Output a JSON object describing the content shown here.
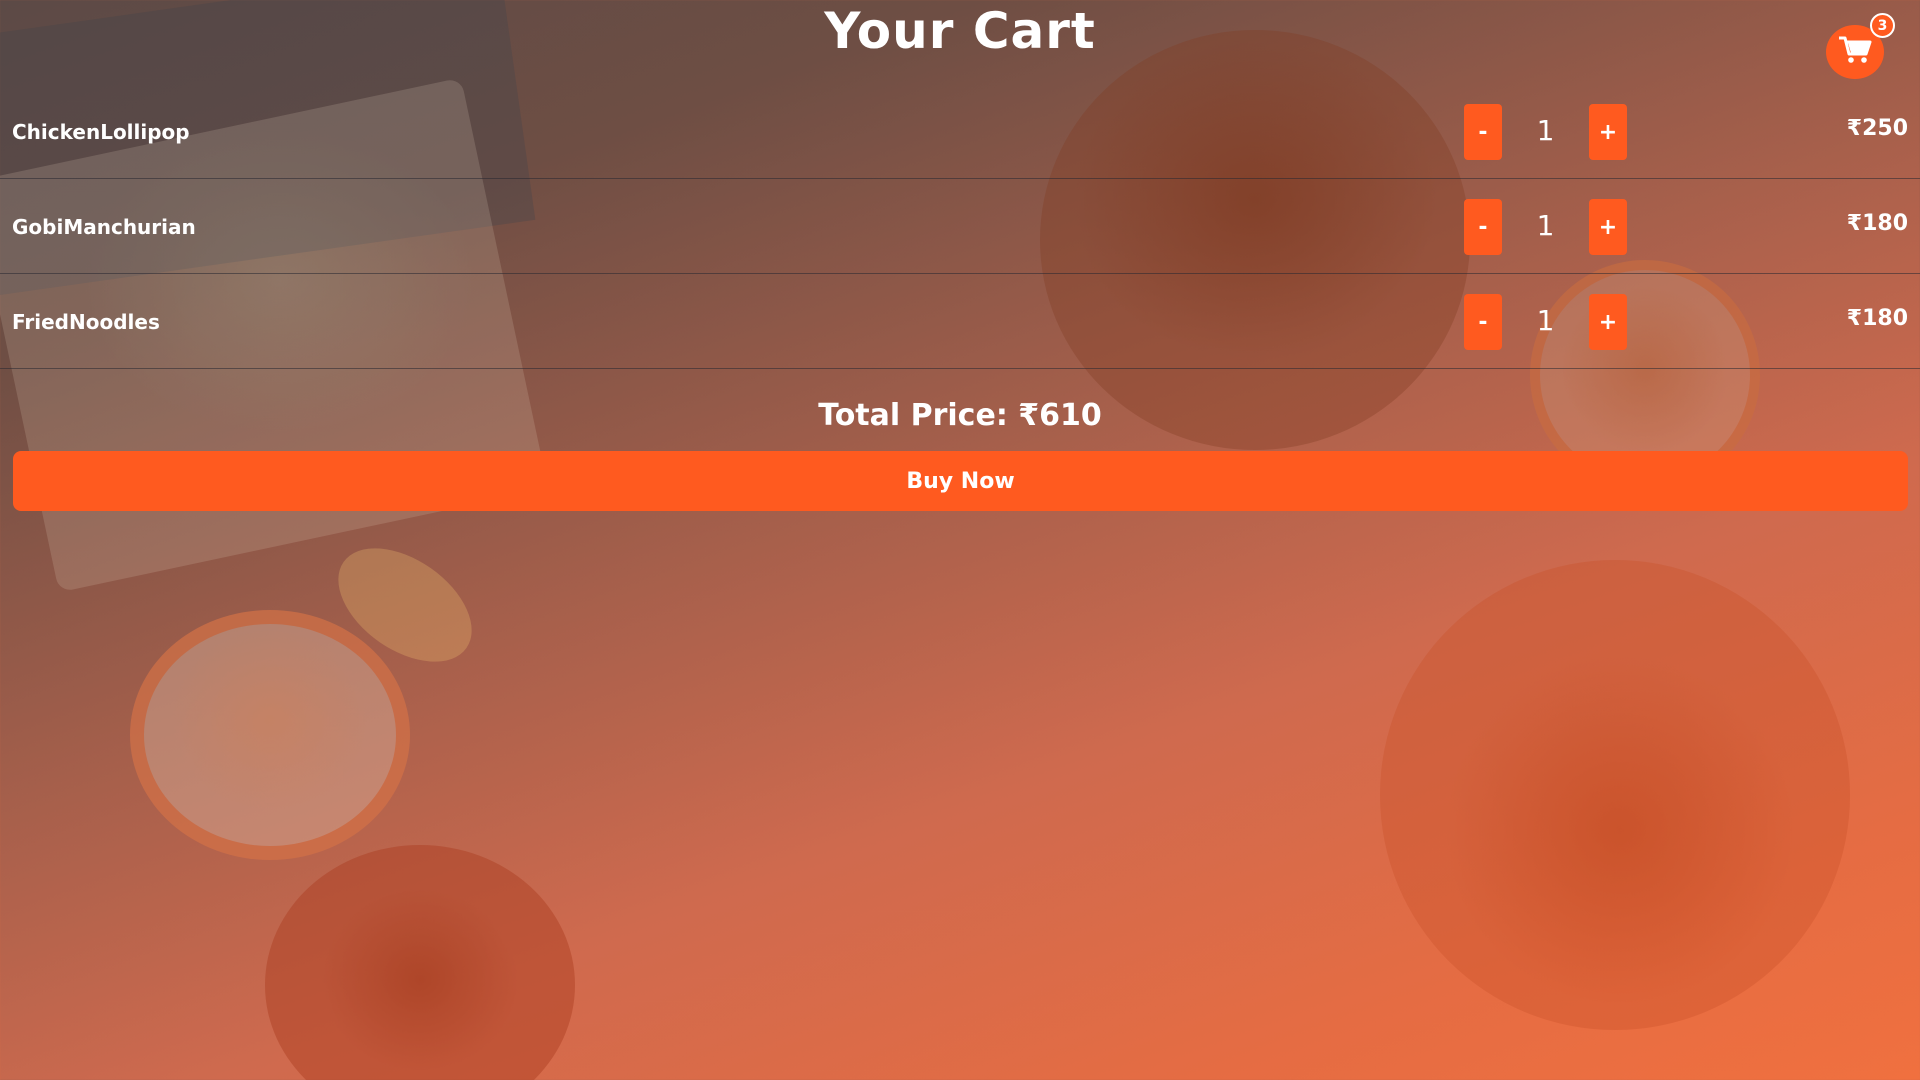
{
  "page": {
    "title": "Your Cart"
  },
  "cart_icon": {
    "icon": "shopping-cart-icon",
    "count": "3"
  },
  "items": [
    {
      "name": "ChickenLollipop",
      "quantity": "1",
      "minus": "-",
      "plus": "+",
      "price": "₹250"
    },
    {
      "name": "GobiManchurian",
      "quantity": "1",
      "minus": "-",
      "plus": "+",
      "price": "₹180"
    },
    {
      "name": "FriedNoodles",
      "quantity": "1",
      "minus": "-",
      "plus": "+",
      "price": "₹180"
    }
  ],
  "summary": {
    "total_label": "Total Price: ₹610"
  },
  "actions": {
    "buy_now": "Buy Now"
  },
  "colors": {
    "accent": "#ff5a1f",
    "text": "#ffffff"
  }
}
